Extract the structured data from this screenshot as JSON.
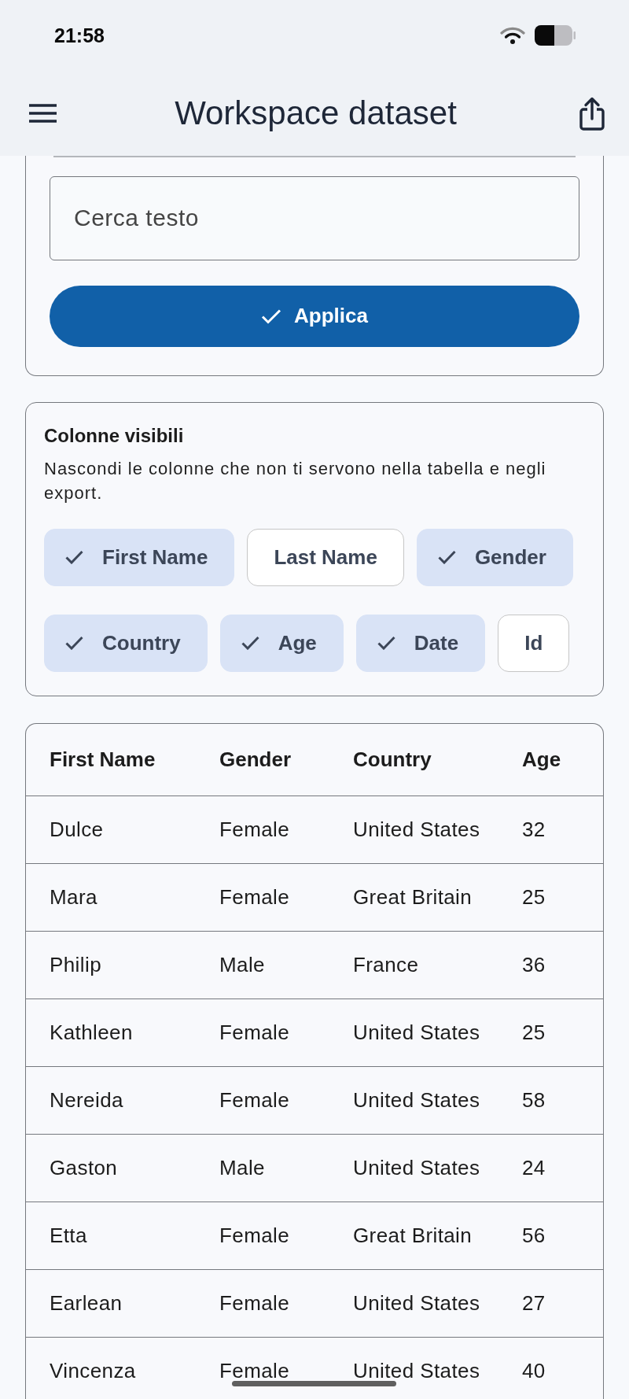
{
  "status_bar": {
    "time": "21:58"
  },
  "app_bar": {
    "title": "Workspace dataset"
  },
  "filter_card": {
    "search_field": {
      "placeholder": "Cerca testo"
    },
    "apply_button": {
      "label": "Applica"
    }
  },
  "columns_card": {
    "title": "Colonne visibili",
    "description": "Nascondi le colonne che non ti servono nella tabella e negli export.",
    "chips": [
      {
        "label": "First Name",
        "selected": true
      },
      {
        "label": "Last Name",
        "selected": false
      },
      {
        "label": "Gender",
        "selected": true
      },
      {
        "label": "Country",
        "selected": true
      },
      {
        "label": "Age",
        "selected": true
      },
      {
        "label": "Date",
        "selected": true
      },
      {
        "label": "Id",
        "selected": false
      }
    ]
  },
  "table": {
    "columns": [
      "First Name",
      "Gender",
      "Country",
      "Age"
    ],
    "rows": [
      [
        "Dulce",
        "Female",
        "United States",
        "32"
      ],
      [
        "Mara",
        "Female",
        "Great Britain",
        "25"
      ],
      [
        "Philip",
        "Male",
        "France",
        "36"
      ],
      [
        "Kathleen",
        "Female",
        "United States",
        "25"
      ],
      [
        "Nereida",
        "Female",
        "United States",
        "58"
      ],
      [
        "Gaston",
        "Male",
        "United States",
        "24"
      ],
      [
        "Etta",
        "Female",
        "Great Britain",
        "56"
      ],
      [
        "Earlean",
        "Female",
        "United States",
        "27"
      ],
      [
        "Vincenza",
        "Female",
        "United States",
        "40"
      ]
    ]
  }
}
